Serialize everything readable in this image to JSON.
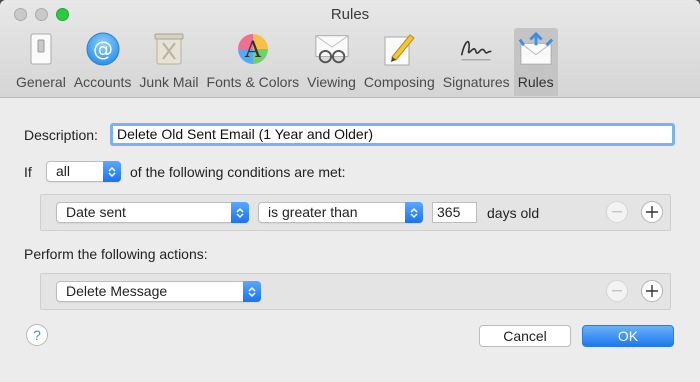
{
  "window": {
    "title": "Rules",
    "controls": {
      "close": "close-button",
      "minimize": "minimize-button",
      "zoom": "zoom-button"
    }
  },
  "toolbar": {
    "tabs": [
      {
        "label": "General",
        "icon": "switch-icon"
      },
      {
        "label": "Accounts",
        "icon": "at-sign-icon"
      },
      {
        "label": "Junk Mail",
        "icon": "trash-bin-icon"
      },
      {
        "label": "Fonts & Colors",
        "icon": "font-palette-icon"
      },
      {
        "label": "Viewing",
        "icon": "glasses-envelope-icon"
      },
      {
        "label": "Composing",
        "icon": "pencil-paper-icon"
      },
      {
        "label": "Signatures",
        "icon": "signature-icon"
      },
      {
        "label": "Rules",
        "icon": "rules-envelope-icon",
        "active": true
      }
    ]
  },
  "rule": {
    "description_label": "Description:",
    "description_value": "Delete Old Sent Email (1 Year and Older)",
    "if_label": "If",
    "match_selected": "all",
    "conditions_suffix": "of the following conditions are met:",
    "condition": {
      "field": "Date sent",
      "operator": "is greater than",
      "value": "365",
      "unit": "days old"
    },
    "actions_label": "Perform the following actions:",
    "action": {
      "type": "Delete Message"
    }
  },
  "buttons": {
    "help": "?",
    "cancel": "Cancel",
    "ok": "OK"
  },
  "colors": {
    "accent": "#1d79ef",
    "focus_ring": "#7eb1ee"
  }
}
